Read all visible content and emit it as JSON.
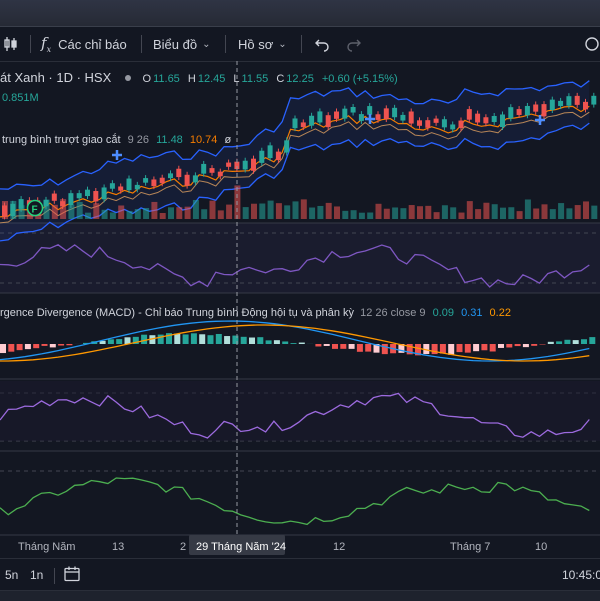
{
  "toolbar": {
    "indicators_label": "Các chỉ báo",
    "chart_label": "Biểu đồ",
    "profile_label": "Hồ sơ"
  },
  "main_legend": {
    "symbol": "át Xanh · 1D · HSX",
    "o_label": "O",
    "o_value": "11.65",
    "h_label": "H",
    "h_value": "12.45",
    "l_label": "L",
    "l_value": "11.55",
    "c_label": "C",
    "c_value": "12.25",
    "change": "+0.60 (+5.15%)",
    "volume": "0.851M"
  },
  "ma_legend": {
    "name": "trung bình trượt giao cắt",
    "p1": "9",
    "p2": "26",
    "v1": "11.48",
    "v2": "10.74",
    "symbol": "ø"
  },
  "macd_legend": {
    "name": "rgence Divergence (MACD) - Chỉ báo Trung bình Động hội tụ và phân kỳ",
    "params": "12 26 close 9",
    "v1": "0.09",
    "v2": "0.31",
    "v3": "0.22"
  },
  "markers": {
    "f_label": "F"
  },
  "time_axis": {
    "labels": [
      "Tháng Năm",
      "13",
      "2",
      "12",
      "Tháng 7",
      "10"
    ],
    "crosshair_label": "29 Tháng Năm '24"
  },
  "bottombar": {
    "tf_5n": "5n",
    "tf_1n": "1n",
    "clock": "10:45:0"
  },
  "colors": {
    "background": "#131722",
    "up": "#26a69a",
    "down": "#ef5350",
    "band": "#2962ff",
    "ma_fast": "#f57c00",
    "rsi": "#7e57c2",
    "green_line": "#4caf50"
  }
}
